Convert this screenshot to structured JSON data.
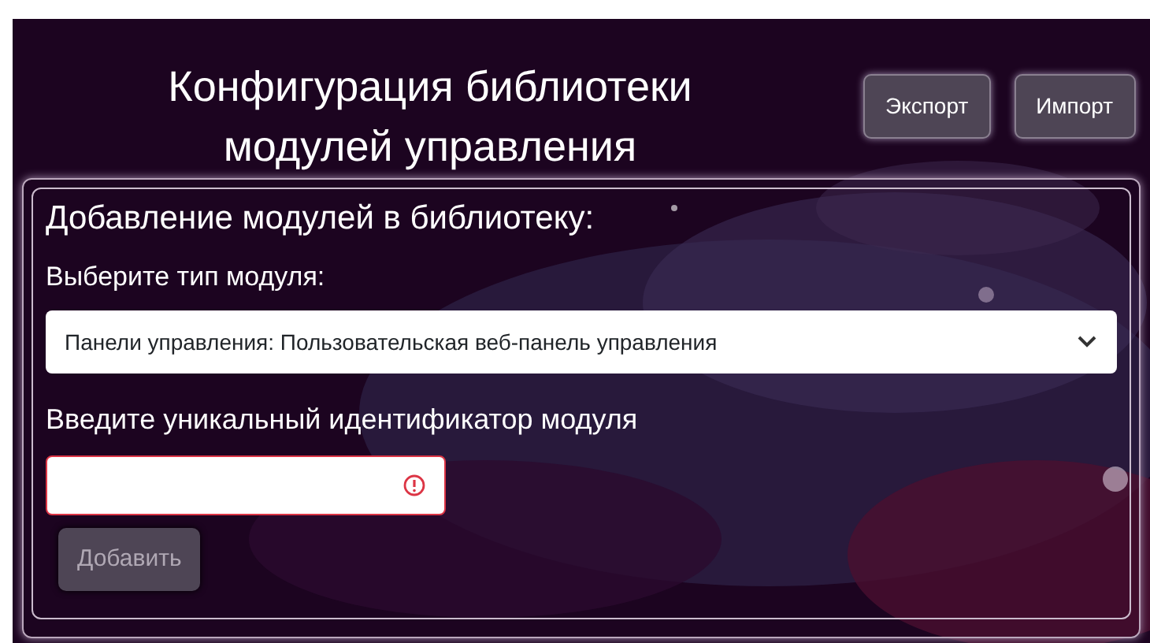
{
  "header": {
    "title_lines": [
      "Конфигурация библиотеки",
      "модулей управления"
    ],
    "buttons": [
      {
        "label": "Экспорт"
      },
      {
        "label": "Импорт"
      }
    ]
  },
  "form": {
    "heading": "Добавление модулей в библиотеку:",
    "type_label": "Выберите тип модуля:",
    "type_select": {
      "value": "Панели управления: Пользовательская веб-панель управления"
    },
    "id_label": "Введите уникальный идентификатор модуля",
    "id_field": {
      "invalid": true
    },
    "add_button": {
      "label": "Добавить",
      "disabled": true
    }
  }
}
